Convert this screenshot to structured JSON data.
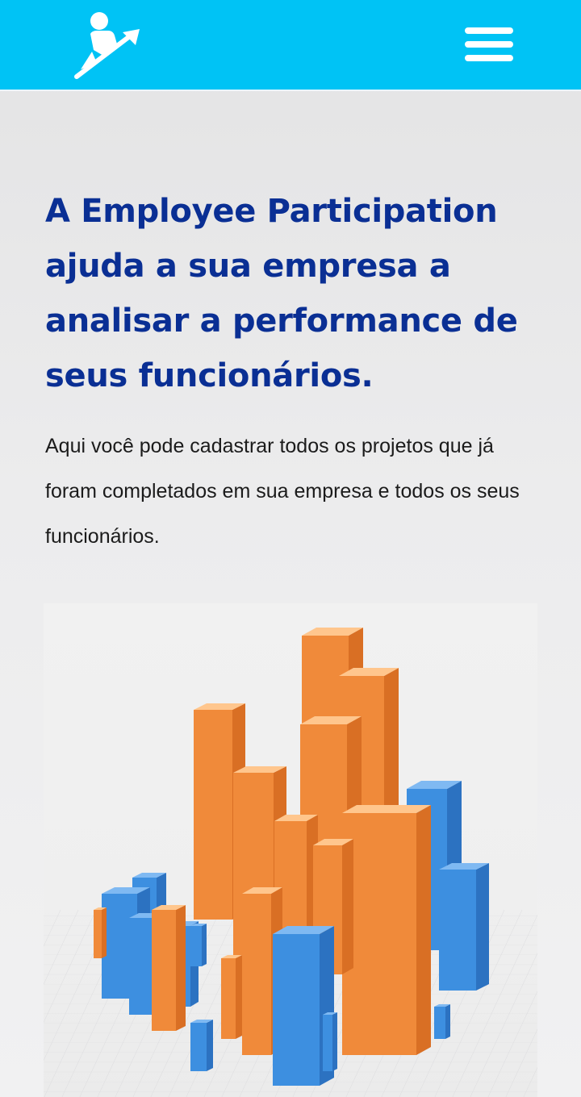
{
  "header": {
    "logo_icon": "person-growth-arrow-icon",
    "menu_icon": "hamburger-menu-icon",
    "background_color": "#00c3f5"
  },
  "hero": {
    "headline": "A Employee Participation ajuda a sua empresa a analisar a performance de seus funcionários.",
    "headline_color": "#0a2f94",
    "description": "Aqui você pode cadastrar todos os projetos que já foram completados em sua empresa e todos os seus funcionários."
  },
  "illustration": {
    "subject": "3d-bar-chart-illustration",
    "colors": {
      "orange": "#f08a3a",
      "blue": "#3d8fe0"
    }
  }
}
